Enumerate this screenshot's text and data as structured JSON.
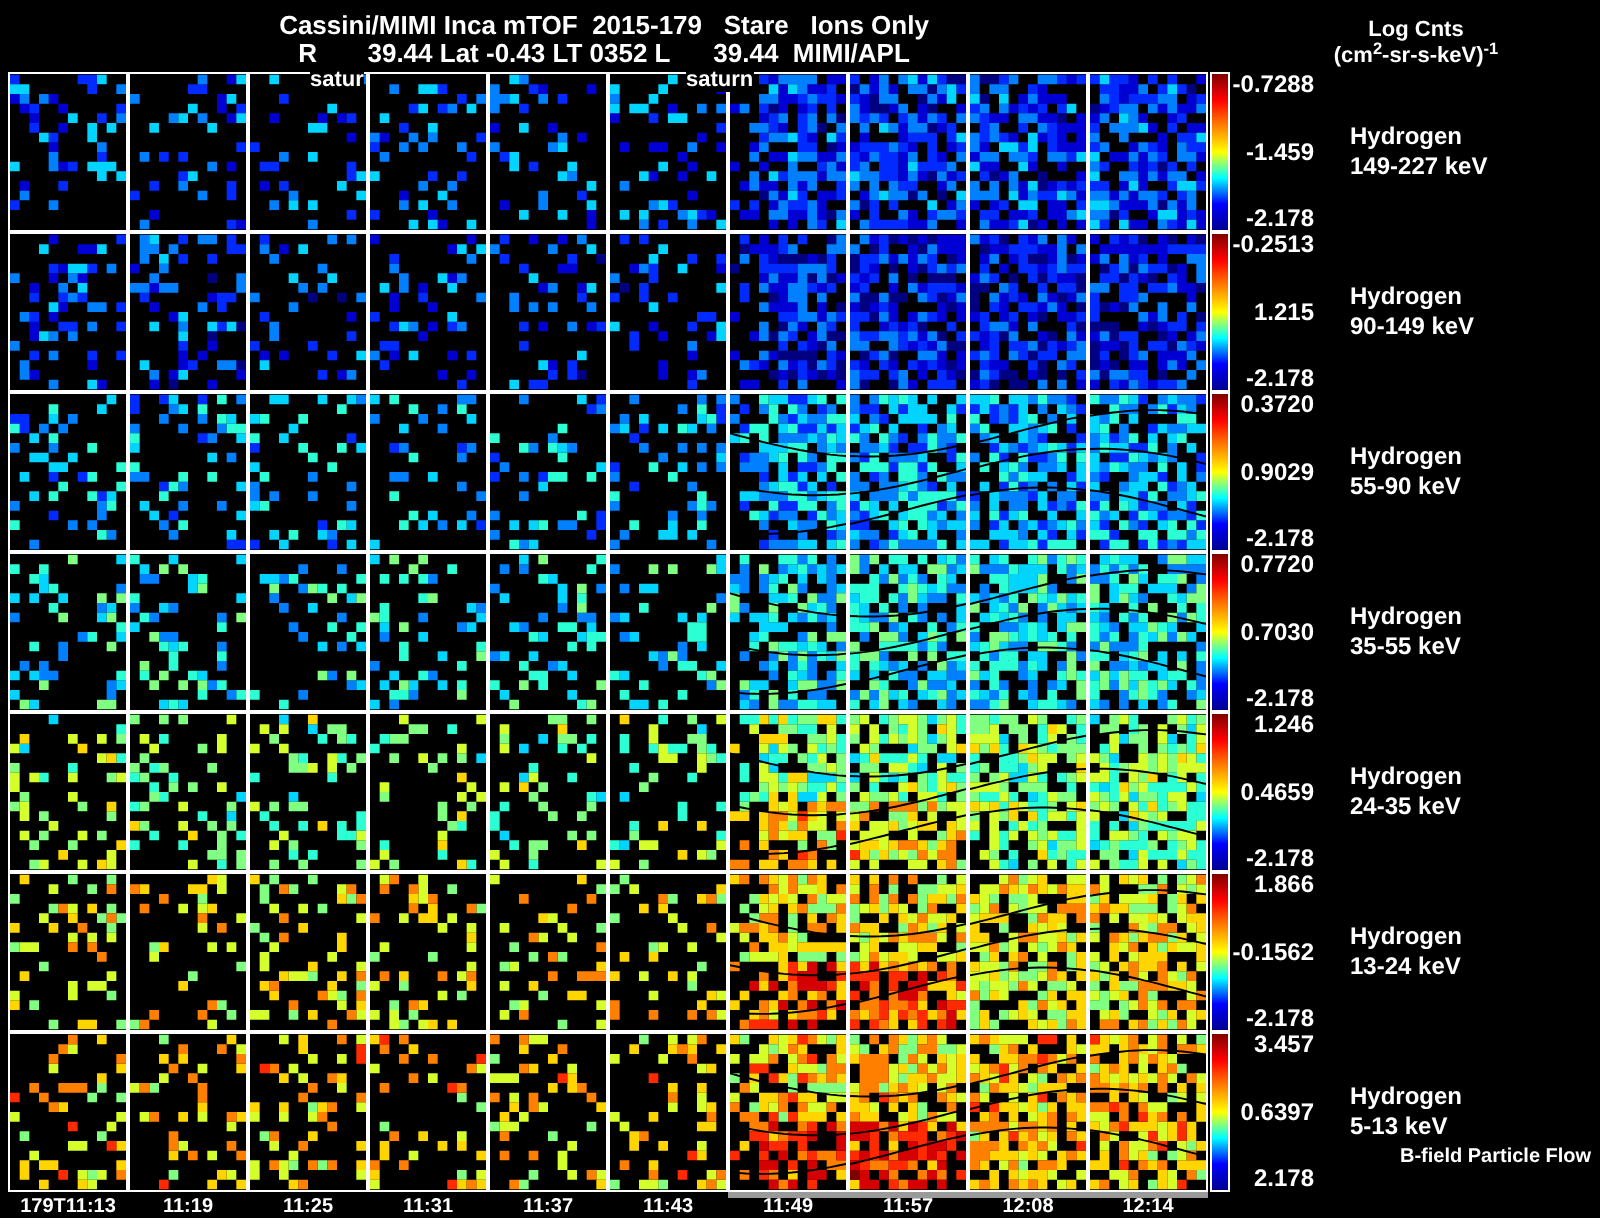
{
  "header": {
    "title": "Cassini/MIMI Inca mTOF  2015-179   Stare   Ions Only",
    "subtitle": "R       39.44 Lat -0.43 LT 0352 L      39.44  MIMI/APL"
  },
  "units": {
    "title": "Log Cnts",
    "unit": "(cm$^{2}$-sr-s-keV)$^{-1}$"
  },
  "planet_labels": [
    "satur",
    "saturn"
  ],
  "rows": [
    {
      "species": "Hydrogen",
      "energy": "149-227 keV",
      "max": "-0.7288",
      "mid": "-1.459",
      "min": "-2.178"
    },
    {
      "species": "Hydrogen",
      "energy": "90-149 keV",
      "max": "-0.2513",
      "mid": "1.215",
      "min": "-2.178"
    },
    {
      "species": "Hydrogen",
      "energy": "55-90 keV",
      "max": "0.3720",
      "mid": "0.9029",
      "min": "-2.178"
    },
    {
      "species": "Hydrogen",
      "energy": "35-55 keV",
      "max": "0.7720",
      "mid": "0.7030",
      "min": "-2.178"
    },
    {
      "species": "Hydrogen",
      "energy": "24-35 keV",
      "max": "1.246",
      "mid": "0.4659",
      "min": "-2.178"
    },
    {
      "species": "Hydrogen",
      "energy": "13-24 keV",
      "max": "1.866",
      "mid": "-0.1562",
      "min": "-2.178"
    },
    {
      "species": "Hydrogen",
      "energy": "5-13 keV",
      "max": "3.457",
      "mid": "0.6397",
      "min": "2.178"
    }
  ],
  "footnote": "B-field Particle Flow",
  "time_labels": [
    "179T11:13",
    "11:19",
    "11:25",
    "11:31",
    "11:37",
    "11:43",
    "11:49",
    "11:57",
    "12:08",
    "12:14"
  ]
}
